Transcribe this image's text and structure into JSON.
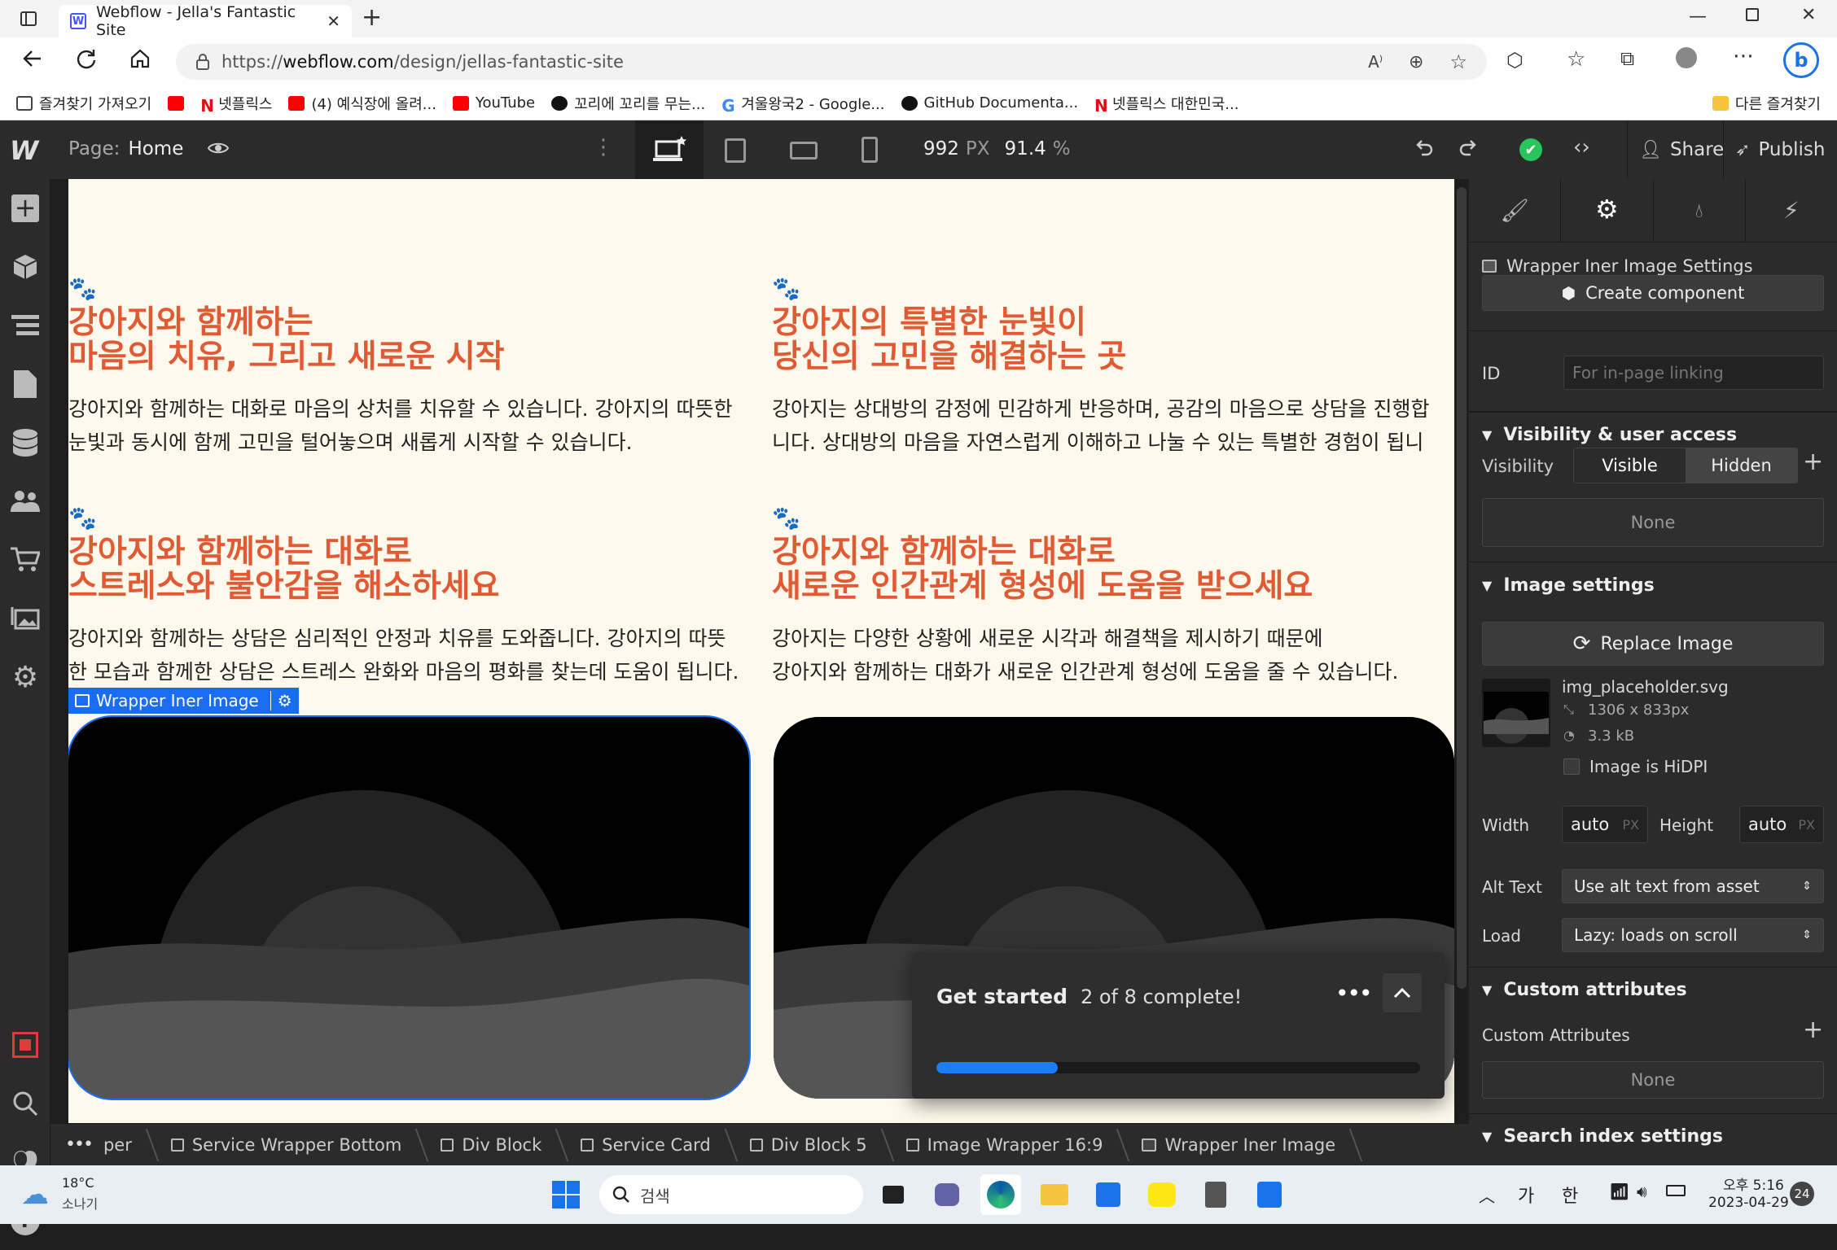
{
  "browser": {
    "tab_title": "Webflow - Jella's Fantastic Site",
    "url_prefix": "https://",
    "url_host": "webflow.com",
    "url_path": "/design/jellas-fantastic-site",
    "bookmarks": [
      {
        "label": "즐겨찾기 가져오기",
        "color": "#444444"
      },
      {
        "label": "",
        "color": "#ff0000"
      },
      {
        "label": "넷플릭스",
        "color": "#e50914"
      },
      {
        "label": "(4) 예식장에 올려...",
        "color": "#ff0000"
      },
      {
        "label": "YouTube",
        "color": "#ff0000"
      },
      {
        "label": "꼬리에 꼬리를 무는...",
        "color": "#111111"
      },
      {
        "label": "겨울왕국2 - Google...",
        "color": "#4285f4"
      },
      {
        "label": "GitHub Documenta...",
        "color": "#111111"
      },
      {
        "label": "넷플릭스 대한민국...",
        "color": "#e50914"
      }
    ],
    "other_bookmarks": "다른 즐겨찾기"
  },
  "topbar": {
    "page_label": "Page:",
    "page_name": "Home",
    "width_value": "992",
    "width_unit": "PX",
    "zoom_value": "91.4",
    "zoom_unit": "%",
    "share": "Share",
    "publish": "Publish"
  },
  "canvas": {
    "cells": [
      {
        "paw": "🐾",
        "heading": "강아지와 함께하는\n마음의 치유, 그리고 새로운 시작",
        "text": "강아지와 함께하는 대화로 마음의 상처를 치유할 수 있습니다. 강아지의 따뜻한\n눈빛과 동시에 함께 고민을 털어놓으며 새롭게 시작할 수 있습니다."
      },
      {
        "paw": "🐾",
        "heading": "강아지의 특별한 눈빛이\n당신의 고민을 해결하는 곳",
        "text": "강아지는 상대방의 감정에 민감하게 반응하며, 공감의 마음으로 상담을 진행합\n니다. 상대방의 마음을 자연스럽게 이해하고 나눌 수 있는 특별한 경험이 됩니"
      },
      {
        "paw": "🐾",
        "heading": "강아지와 함께하는 대화로\n스트레스와 불안감을 해소하세요",
        "text": "강아지와 함께하는 상담은 심리적인 안정과 치유를 도와줍니다. 강아지의 따뜻\n한 모습과 함께한 상담은 스트레스 완화와 마음의 평화를 찾는데 도움이 됩니다."
      },
      {
        "paw": "🐾",
        "heading": "강아지와 함께하는 대화로\n새로운 인간관계 형성에 도움을 받으세요",
        "text": "강아지는 다양한 상황에 새로운 시각과 해결책을 제시하기 때문에\n강아지와 함께하는 대화가 새로운 인간관계 형성에 도움을 줄 수 있습니다."
      }
    ],
    "selected_label": "Wrapper Iner Image"
  },
  "panel": {
    "settings_title": "Wrapper Iner Image Settings",
    "create_component": "Create component",
    "id_label": "ID",
    "id_placeholder": "For in-page linking",
    "visibility_section": "Visibility & user access",
    "visibility_label": "Visibility",
    "visible": "Visible",
    "hidden": "Hidden",
    "none": "None",
    "image_section": "Image settings",
    "replace_image": "Replace Image",
    "file_name": "img_placeholder.svg",
    "dimensions": "1306 x 833px",
    "size": "3.3 kB",
    "hidpi": "Image is HiDPI",
    "width_label": "Width",
    "height_label": "Height",
    "auto": "auto",
    "px": "PX",
    "alt_label": "Alt Text",
    "alt_value": "Use alt text from asset",
    "load_label": "Load",
    "load_value": "Lazy: loads on scroll",
    "custom_section": "Custom attributes",
    "custom_label": "Custom Attributes",
    "custom_none": "None",
    "search_section": "Search index settings"
  },
  "breadcrumbs": [
    "per",
    "Service Wrapper Bottom",
    "Div Block",
    "Service Card",
    "Div Block 5",
    "Image Wrapper 16:9",
    "Wrapper Iner Image"
  ],
  "getstarted": {
    "title": "Get started",
    "progress_text": "2 of 8 complete!",
    "progress": 0.25
  },
  "taskbar": {
    "temp": "18°C",
    "weather": "소나기",
    "search": "검색",
    "ime1": "가",
    "ime2": "한",
    "time": "오후 5:16",
    "date": "2023-04-29",
    "badge": "24"
  },
  "colors": {
    "accent": "#4353ff",
    "heading": "#e25a33",
    "progress": "#1a7ef7"
  }
}
